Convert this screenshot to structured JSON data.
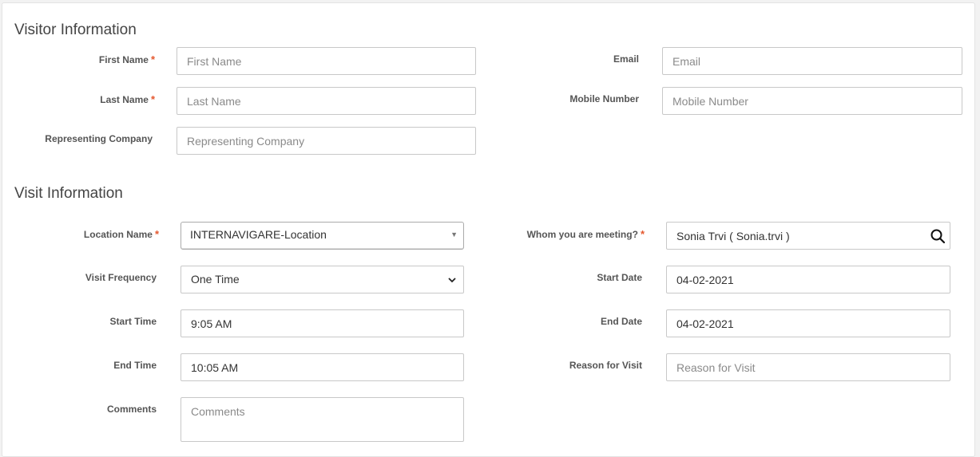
{
  "visitor": {
    "title": "Visitor Information",
    "first_name": {
      "label": "First Name",
      "required": "*",
      "placeholder": "First Name",
      "value": ""
    },
    "last_name": {
      "label": "Last Name",
      "required": "*",
      "placeholder": "Last Name",
      "value": ""
    },
    "company": {
      "label": "Representing Company",
      "placeholder": "Representing Company",
      "value": ""
    },
    "email": {
      "label": "Email",
      "placeholder": "Email",
      "value": ""
    },
    "mobile": {
      "label": "Mobile Number",
      "placeholder": "Mobile Number",
      "value": ""
    }
  },
  "visit": {
    "title": "Visit Information",
    "location": {
      "label": "Location Name",
      "required": "*",
      "value": "INTERNAVIGARE-Location"
    },
    "frequency": {
      "label": "Visit Frequency",
      "value": "One Time"
    },
    "start_time": {
      "label": "Start Time",
      "value": "9:05 AM"
    },
    "end_time": {
      "label": "End Time",
      "value": "10:05 AM"
    },
    "comments": {
      "label": "Comments",
      "placeholder": "Comments"
    },
    "meeting": {
      "label": "Whom you are meeting?",
      "required": "*",
      "value": "Sonia Trvi ( Sonia.trvi )"
    },
    "start_date": {
      "label": "Start Date",
      "value": "04-02-2021"
    },
    "end_date": {
      "label": "End Date",
      "value": "04-02-2021"
    },
    "reason": {
      "label": "Reason for Visit",
      "placeholder": "Reason for Visit",
      "value": ""
    }
  },
  "icons": {
    "meeting_search": "search-icon",
    "frequency_dropdown": "chevron-down-icon",
    "location_dropdown": "caret-down-icon"
  },
  "colors": {
    "required": "#e4572e",
    "border": "#c8c8c8"
  }
}
